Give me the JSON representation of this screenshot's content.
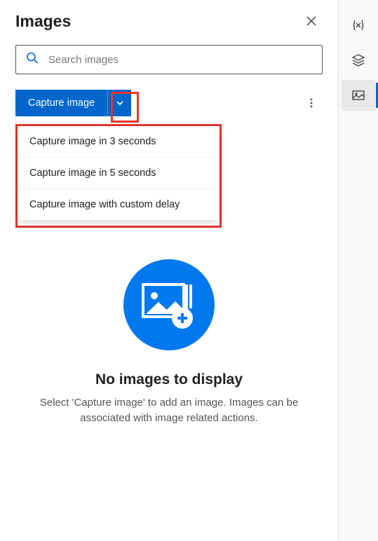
{
  "panel": {
    "title": "Images"
  },
  "search": {
    "placeholder": "Search images"
  },
  "toolbar": {
    "capture_label": "Capture image"
  },
  "dropdown": {
    "items": [
      {
        "label": "Capture image in 3 seconds"
      },
      {
        "label": "Capture image in 5 seconds"
      },
      {
        "label": "Capture image with custom delay"
      }
    ]
  },
  "empty": {
    "title": "No images to display",
    "description": "Select 'Capture image' to add an image. Images can be associated with image related actions."
  },
  "rail": {
    "variables": "variables-icon",
    "layers": "layers-icon",
    "images": "images-icon"
  }
}
